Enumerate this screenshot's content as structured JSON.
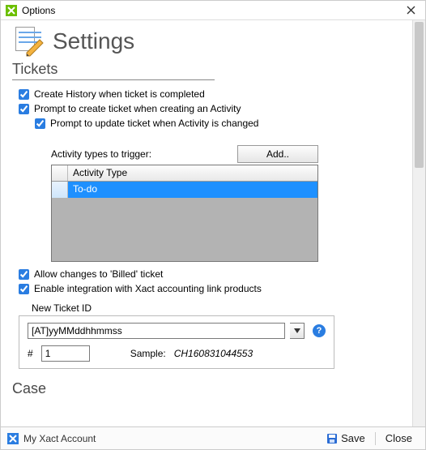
{
  "window": {
    "title": "Options"
  },
  "header": {
    "title": "Settings"
  },
  "sections": {
    "tickets": {
      "title": "Tickets",
      "chk_create_history": "Create History when ticket is completed",
      "chk_prompt_create": "Prompt to create ticket when creating an Activity",
      "chk_prompt_update": "Prompt to update ticket when Activity is changed",
      "activity_caption": "Activity types to trigger:",
      "add_button": "Add..",
      "grid_header": "Activity Type",
      "grid_rows": [
        "To-do"
      ],
      "chk_allow_billed": "Allow changes to 'Billed' ticket",
      "chk_xact_integration": "Enable integration with Xact accounting link products",
      "newid_caption": "New Ticket ID",
      "format_value": "[AT]yyMMddhhmmss",
      "hash_label": "#",
      "hash_value": "1",
      "sample_label": "Sample:",
      "sample_value": "CH160831044553"
    },
    "case": {
      "title": "Case"
    }
  },
  "footer": {
    "account": "My Xact Account",
    "save": "Save",
    "close": "Close"
  }
}
